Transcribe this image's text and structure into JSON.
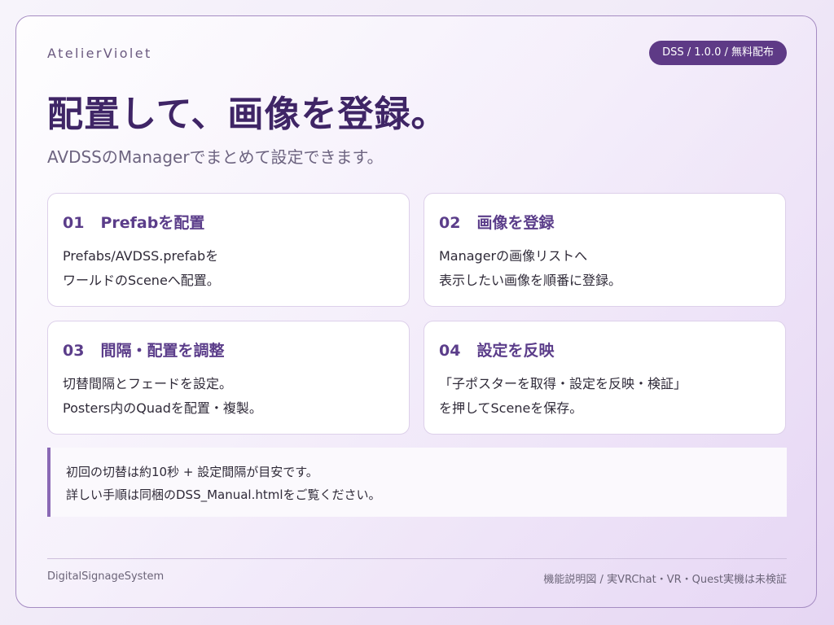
{
  "header": {
    "brand": "AtelierViolet",
    "badge": "DSS / 1.0.0 / 無料配布",
    "title": "配置して、画像を登録。",
    "subtitle": "AVDSSのManagerでまとめて設定できます。"
  },
  "steps": [
    {
      "number": "01",
      "heading": "Prefabを配置",
      "lines": [
        "Prefabs/AVDSS.prefabを",
        "ワールドのSceneへ配置。"
      ]
    },
    {
      "number": "02",
      "heading": "画像を登録",
      "lines": [
        "Managerの画像リストへ",
        "表示したい画像を順番に登録。"
      ]
    },
    {
      "number": "03",
      "heading": "間隔・配置を調整",
      "lines": [
        "切替間隔とフェードを設定。",
        "Posters内のQuadを配置・複製。"
      ]
    },
    {
      "number": "04",
      "heading": "設定を反映",
      "lines": [
        "「子ポスターを取得・設定を反映・検証」",
        "を押してSceneを保存。"
      ]
    }
  ],
  "note": {
    "lines": [
      "初回の切替は約10秒 + 設定間隔が目安です。",
      "詳しい手順は同梱のDSS_Manual.htmlをご覧ください。"
    ]
  },
  "footer": {
    "left": "DigitalSignageSystem",
    "right": "機能説明図 / 実VRChat・VR・Quest実機は未検証"
  },
  "colors": {
    "accent": "#5e3a86",
    "title": "#3f2566",
    "heading": "#5b3d8a",
    "border": "#a58cc2"
  }
}
